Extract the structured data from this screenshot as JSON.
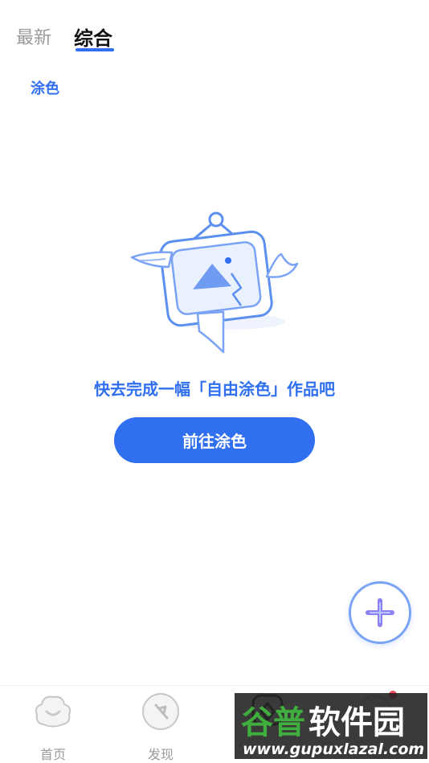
{
  "tabs": [
    {
      "label": "最新"
    },
    {
      "label": "综合"
    }
  ],
  "category": {
    "label": "涂色"
  },
  "empty_state": {
    "message": "快去完成一幅「自由涂色」作品吧",
    "button_label": "前往涂色"
  },
  "bottom_nav": [
    {
      "label": "首页",
      "icon": "cloud-smile-icon"
    },
    {
      "label": "发现",
      "icon": "compass-icon"
    },
    {
      "label": "",
      "icon": "create-icon"
    },
    {
      "label": "",
      "icon": "profile-icon"
    }
  ],
  "watermark": {
    "title": "谷普软件园",
    "url": "www.gupuxlazal.com"
  },
  "colors": {
    "accent": "#2f6ff0",
    "fab_border": "#7aa3f5",
    "badge": "#f04a5c",
    "muted_text": "#9a9a9a"
  }
}
